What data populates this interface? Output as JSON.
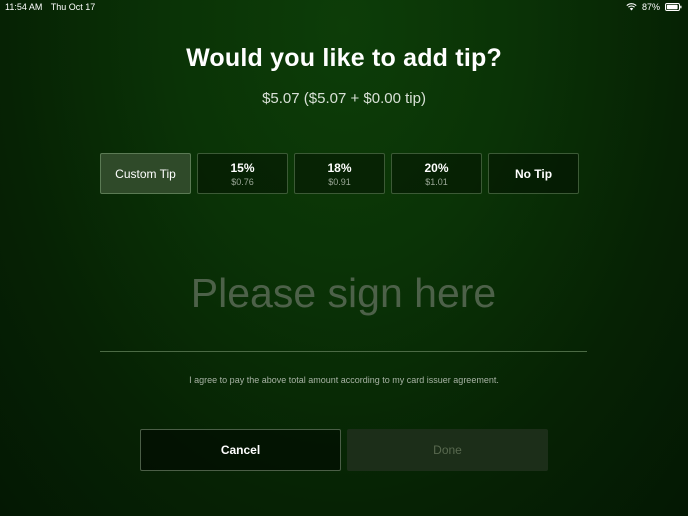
{
  "status_bar": {
    "time": "11:54 AM",
    "date": "Thu Oct 17",
    "battery": "87%"
  },
  "header": {
    "title": "Would you like to add tip?",
    "total": "$5.07 ($5.07 + $0.00 tip)"
  },
  "tips": [
    {
      "label": "Custom Tip",
      "amount": "",
      "selected": true
    },
    {
      "label": "15%",
      "amount": "$0.76"
    },
    {
      "label": "18%",
      "amount": "$0.91"
    },
    {
      "label": "20%",
      "amount": "$1.01"
    },
    {
      "label": "No Tip",
      "amount": ""
    }
  ],
  "signature": {
    "placeholder": "Please sign here"
  },
  "agreement": "I agree to pay the above total amount according to my card issuer agreement.",
  "actions": {
    "cancel": "Cancel",
    "done": "Done"
  },
  "colors": {
    "background": "#0a3306",
    "accent_selected": "#2f4a29",
    "border": "#3c5a36"
  },
  "icons": [
    "wifi-icon",
    "battery-icon"
  ]
}
